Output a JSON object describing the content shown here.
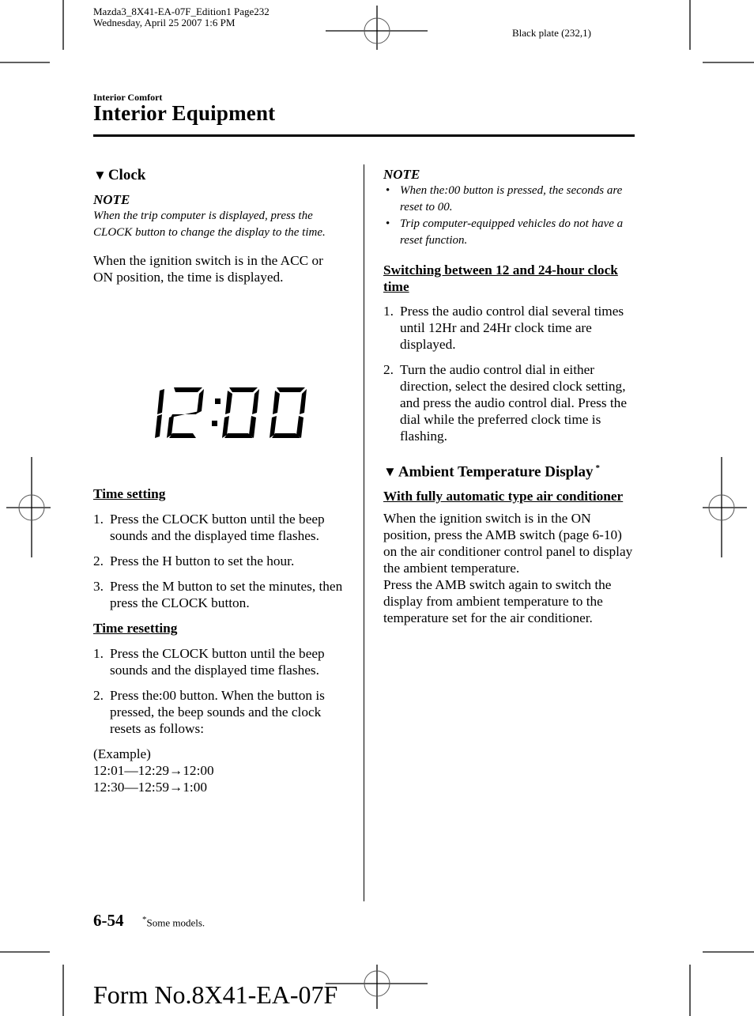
{
  "print_header": {
    "job_line": "Mazda3_8X41-EA-07F_Edition1 Page232",
    "date_line": "Wednesday, April 25 2007 1:6 PM",
    "plate": "Black plate (232,1)"
  },
  "header": {
    "section_label": "Interior Comfort",
    "page_title": "Interior Equipment"
  },
  "left_column": {
    "clock_section": {
      "marker": "▼",
      "title": "Clock",
      "note_title": "NOTE",
      "note_text": "When the trip computer is displayed, press the CLOCK button to change the display to the time.",
      "intro": "When the ignition switch is in the ACC or ON position, the time is displayed.",
      "figure": {
        "display_value": "12:00"
      }
    },
    "time_setting": {
      "heading": "Time setting",
      "steps": [
        {
          "num": "1.",
          "text": "Press the CLOCK button until the beep sounds and the displayed time flashes."
        },
        {
          "num": "2.",
          "text": "Press the H button to set the hour."
        },
        {
          "num": "3.",
          "text": "Press the M button to set the minutes, then press the CLOCK button."
        }
      ]
    },
    "time_resetting": {
      "heading": "Time resetting",
      "steps": [
        {
          "num": "1.",
          "text": "Press the CLOCK button until the beep sounds and the displayed time flashes."
        },
        {
          "num": "2.",
          "text": "Press the:00 button. When the button is pressed, the beep sounds and the clock resets as follows:"
        }
      ],
      "example_label": "(Example)",
      "example_lines": [
        "12:01―12:29→12:00",
        "12:30―12:59→1:00"
      ]
    }
  },
  "right_column": {
    "note": {
      "title": "NOTE",
      "bullet": "•",
      "items": [
        "When the:00 button is pressed, the seconds are reset to 00.",
        "Trip computer-equipped vehicles do not have a reset function."
      ]
    },
    "switching": {
      "heading": "Switching between 12 and 24-hour clock time",
      "steps": [
        {
          "num": "1.",
          "text": "Press the audio control dial several times until 12Hr and 24Hr clock time are displayed."
        },
        {
          "num": "2.",
          "text": "Turn the audio control dial in either direction, select the desired clock setting, and press the audio control dial. Press the dial while the preferred clock time is flashing."
        }
      ]
    },
    "ambient": {
      "marker": "▼",
      "title": "Ambient Temperature Display",
      "asterisk": "*",
      "sub_heading": "With fully automatic type air conditioner",
      "text_1": "When the ignition switch is in the ON position, press the AMB switch (page 6-10) on the air conditioner control panel to display the ambient temperature.",
      "text_2": "Press the AMB switch again to switch the display from ambient temperature to the temperature set for the air conditioner."
    }
  },
  "footer": {
    "page_number": "6-54",
    "footnote_asterisk": "*",
    "footnote_text": "Some models.",
    "form_number": "Form No.8X41-EA-07F"
  }
}
